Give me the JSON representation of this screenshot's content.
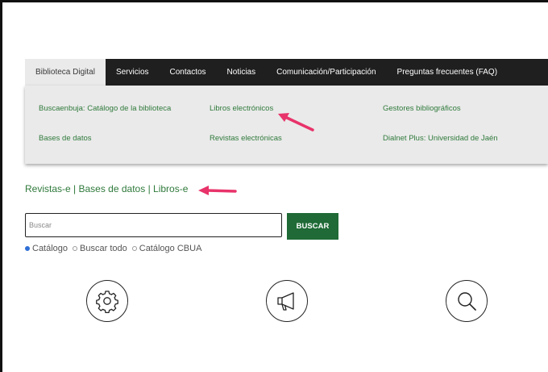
{
  "nav": {
    "items": [
      {
        "label": "Biblioteca Digital",
        "active": true
      },
      {
        "label": "Servicios",
        "active": false
      },
      {
        "label": "Contactos",
        "active": false
      },
      {
        "label": "Noticias",
        "active": false
      },
      {
        "label": "Comunicación/Participación",
        "active": false
      },
      {
        "label": "Preguntas frecuentes (FAQ)",
        "active": false
      }
    ]
  },
  "dropdown": {
    "links": [
      "Buscaenbuja: Catálogo de la biblioteca",
      "Libros electrónicos",
      "Gestores bibliográficos",
      "Bases de datos",
      "Revistas electrónicas",
      "Dialnet Plus: Universidad de Jaén"
    ]
  },
  "quick_links": {
    "items": [
      "Revistas-e",
      "Bases de datos",
      "Libros-e"
    ],
    "separator": "|"
  },
  "search": {
    "placeholder": "Buscar",
    "button_label": "BUSCAR",
    "options": [
      {
        "label": "Catálogo",
        "checked": true
      },
      {
        "label": "Buscar todo",
        "checked": false
      },
      {
        "label": "Catálogo CBUA",
        "checked": false
      }
    ]
  },
  "icons": [
    "gear-icon",
    "megaphone-icon",
    "search-icon"
  ],
  "colors": {
    "nav_bg": "#1f1f1f",
    "dropdown_bg": "#eaeaea",
    "link_green": "#2f7a3b",
    "button_green": "#1f6a36",
    "annotation_arrow": "#e8336a"
  }
}
